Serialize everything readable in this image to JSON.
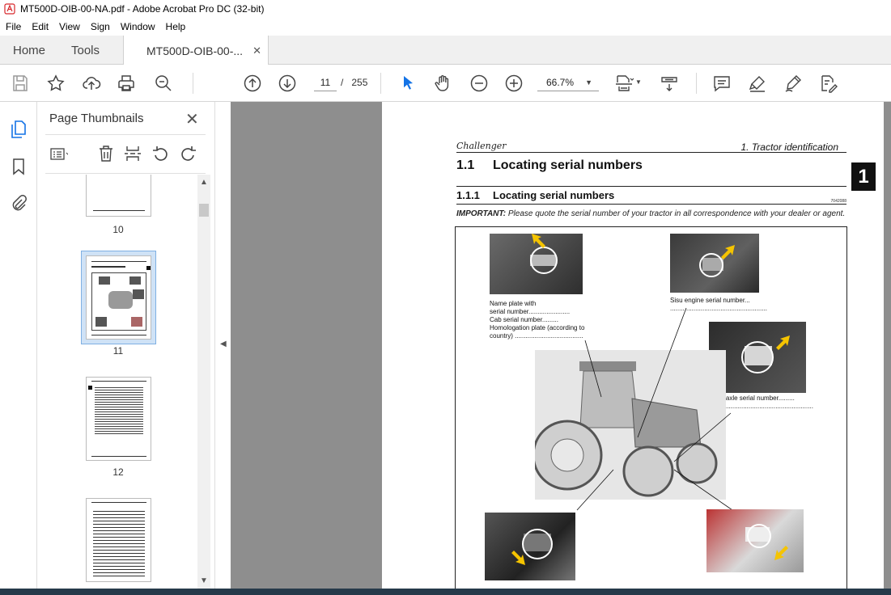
{
  "window": {
    "title": "MT500D-OIB-00-NA.pdf - Adobe Acrobat Pro DC (32-bit)"
  },
  "menu": [
    "File",
    "Edit",
    "View",
    "Sign",
    "Window",
    "Help"
  ],
  "tabs": {
    "home": "Home",
    "tools": "Tools",
    "document": "MT500D-OIB-00-...",
    "close": "✕"
  },
  "toolbar": {
    "current_page": "11",
    "page_sep": "/",
    "total_pages": "255",
    "zoom": "66.7%"
  },
  "panel": {
    "title": "Page Thumbnails",
    "thumbnails": [
      {
        "label": "10"
      },
      {
        "label": "11"
      },
      {
        "label": "12"
      }
    ]
  },
  "page": {
    "brand": "Challenger",
    "header_right": "1. Tractor identification",
    "chapter_tab": "1",
    "h1_num": "1.1",
    "h1_text": "Locating serial numbers",
    "h2_num": "1.1.1",
    "h2_text": "Locating serial numbers",
    "image_ref": "7042088",
    "important_label": "IMPORTANT:",
    "important_text": " Please quote the serial number of your tractor in all correspondence with your dealer or agent.",
    "captions": {
      "name_plate": "Name plate with\nserial number.......................\nCab serial number.........\nHomologation plate (according to\ncountry) ......................................",
      "sisu": "Sisu engine serial number...\n......................................................",
      "front_axle": "Front axle serial number.........\n.........................................................."
    }
  },
  "colors": {
    "accent": "#1473e6",
    "arrow": "#f5c400",
    "doc_bg": "#8e8e8e"
  }
}
